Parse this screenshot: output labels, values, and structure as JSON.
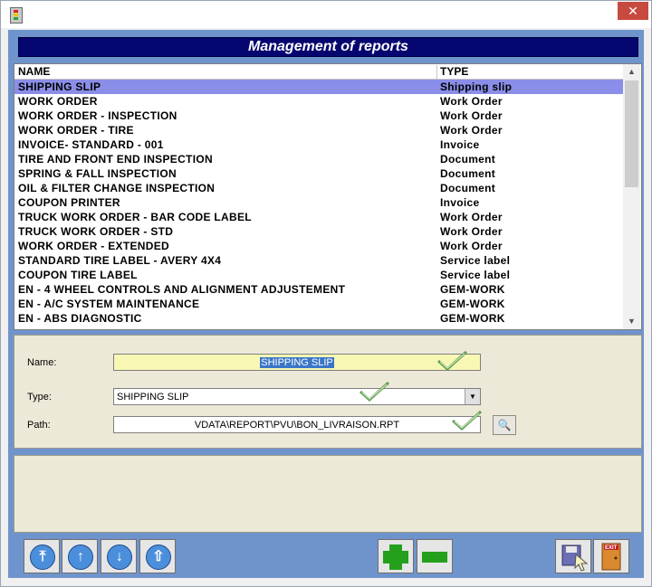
{
  "window": {
    "close_glyph": "✕"
  },
  "header": {
    "title": "Management of reports"
  },
  "grid": {
    "columns": [
      "NAME",
      "TYPE"
    ],
    "rows": [
      {
        "name": "SHIPPING SLIP",
        "type": "Shipping slip",
        "selected": true
      },
      {
        "name": "WORK ORDER",
        "type": "Work Order"
      },
      {
        "name": "WORK ORDER - INSPECTION",
        "type": "Work Order"
      },
      {
        "name": "WORK ORDER - TIRE",
        "type": "Work Order"
      },
      {
        "name": "INVOICE- STANDARD - 001",
        "type": "Invoice"
      },
      {
        "name": "TIRE AND FRONT END INSPECTION",
        "type": "Document"
      },
      {
        "name": "SPRING & FALL INSPECTION",
        "type": "Document"
      },
      {
        "name": "OIL & FILTER CHANGE INSPECTION",
        "type": "Document"
      },
      {
        "name": "COUPON PRINTER",
        "type": "Invoice"
      },
      {
        "name": "TRUCK WORK ORDER - BAR CODE LABEL",
        "type": "Work Order"
      },
      {
        "name": "TRUCK WORK ORDER - STD",
        "type": "Work Order"
      },
      {
        "name": "WORK ORDER - EXTENDED",
        "type": "Work Order"
      },
      {
        "name": "STANDARD TIRE LABEL - AVERY 4X4",
        "type": "Service label"
      },
      {
        "name": "COUPON TIRE LABEL",
        "type": "Service label"
      },
      {
        "name": "EN - 4 WHEEL CONTROLS AND ALIGNMENT ADJUSTEMENT",
        "type": "GEM-WORK"
      },
      {
        "name": "EN - A/C SYSTEM MAINTENANCE",
        "type": "GEM-WORK"
      },
      {
        "name": "EN - ABS DIAGNOSTIC",
        "type": "GEM-WORK"
      }
    ]
  },
  "form": {
    "name_label": "Name:",
    "name_value": "SHIPPING SLIP",
    "type_label": "Type:",
    "type_value": "SHIPPING SLIP",
    "path_label": "Path:",
    "path_value": "VDATA\\REPORT\\PVU\\BON_LIVRAISON.RPT"
  },
  "toolbar": {
    "exit_label": "EXIT"
  },
  "colors": {
    "header_bg": "#060670",
    "selection": "#8a8ee8",
    "name_field_bg": "#f8f7b4",
    "client_bg": "#6f94cc"
  }
}
